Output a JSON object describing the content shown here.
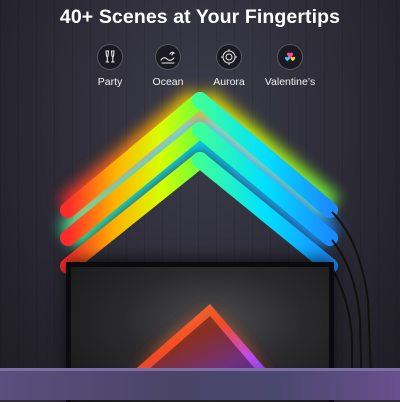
{
  "headline": "40+ Scenes at Your Fingertips",
  "scenes": [
    {
      "label": "Party",
      "icon": "champagne-glasses-icon"
    },
    {
      "label": "Ocean",
      "icon": "wave-icon"
    },
    {
      "label": "Aurora",
      "icon": "aurora-icon"
    },
    {
      "label": "Valentine’s",
      "icon": "hearts-icon"
    }
  ],
  "colors": {
    "wall": "#2c2b36",
    "text": "#ffffff",
    "light_left": [
      "#ff2a2a",
      "#ffb000",
      "#f2ff00",
      "#7dff2a"
    ],
    "light_right": [
      "#33ff9a",
      "#00e5ff",
      "#1a9bff"
    ],
    "triangle": [
      "#ff3b1f",
      "#ff9a3a",
      "#c94cff",
      "#6a3bff"
    ]
  }
}
